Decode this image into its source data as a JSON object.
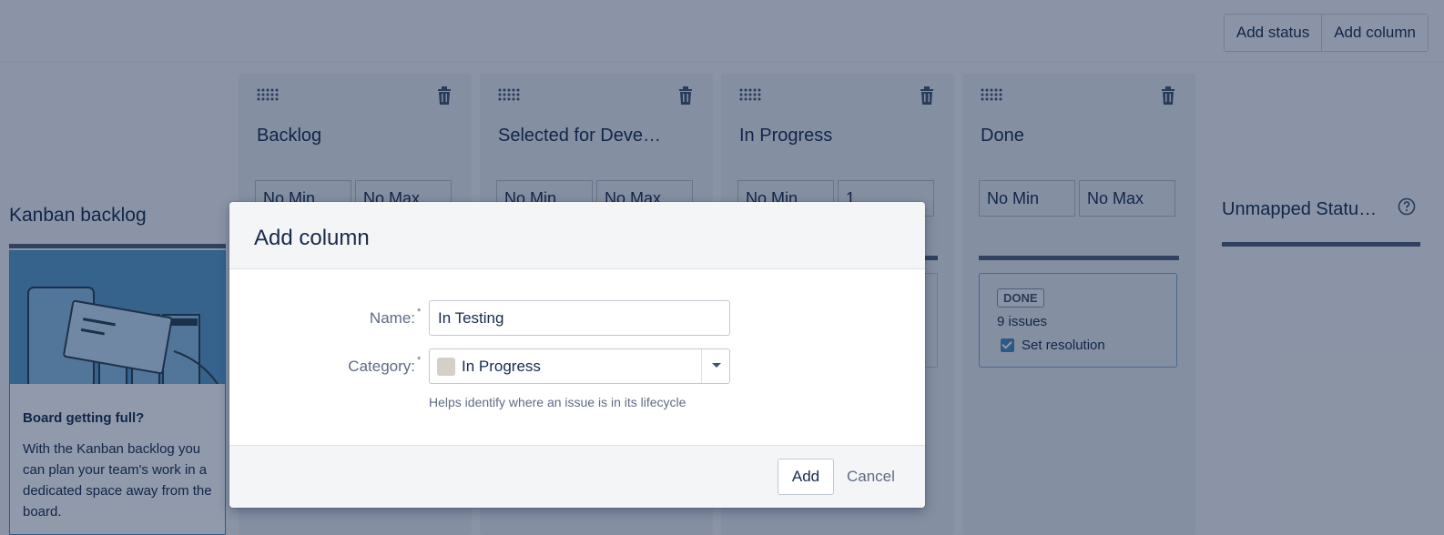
{
  "toolbar": {
    "add_status_label": "Add status",
    "add_column_label": "Add column"
  },
  "kanban_backlog": {
    "title": "Kanban backlog",
    "card_heading": "Board getting full?",
    "card_text": "With the Kanban backlog you can plan your team's work in a dedicated space away from the board."
  },
  "columns": [
    {
      "title": "Backlog",
      "min": "No Min",
      "max": "No Max"
    },
    {
      "title": "Selected for Deve…",
      "min": "No Min",
      "max": "No Max"
    },
    {
      "title": "In Progress",
      "min": "No Min",
      "max": "1"
    },
    {
      "title": "Done",
      "min": "No Min",
      "max": "No Max",
      "status": {
        "lozenge": "DONE",
        "issues": "9 issues",
        "set_resolution": "Set resolution",
        "set_resolution_checked": true
      }
    }
  ],
  "unmapped": {
    "title": "Unmapped Statu…",
    "icon": "help-icon"
  },
  "dialog": {
    "title": "Add column",
    "name_label": "Name:",
    "name_value": "In Testing",
    "required_mark": "*",
    "category_label": "Category:",
    "category_value": "In Progress",
    "category_swatch_color": "#d4d0c8",
    "category_hint": "Helps identify where an issue is in its lifecycle",
    "add_label": "Add",
    "cancel_label": "Cancel"
  },
  "colors": {
    "overlay": "rgba(9,30,66,0.45)",
    "accent_blue": "#4a8bbd",
    "bar_dark": "#505f79"
  }
}
